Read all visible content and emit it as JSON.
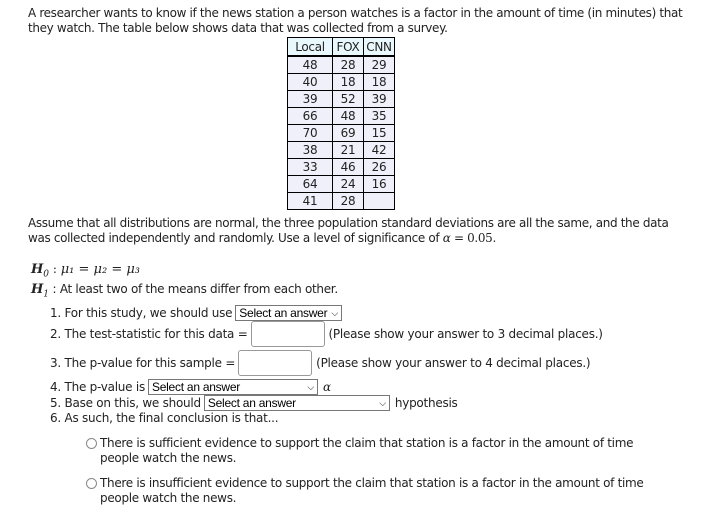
{
  "intro": "A researcher wants to know if the news station a person watches is a factor in the amount of time (in minutes) that they watch. The table below shows data that was collected from a survey.",
  "table": {
    "headers": [
      "Local",
      "FOX",
      "CNN"
    ],
    "rows": [
      [
        "48",
        "28",
        "29"
      ],
      [
        "40",
        "18",
        "18"
      ],
      [
        "39",
        "52",
        "39"
      ],
      [
        "66",
        "48",
        "35"
      ],
      [
        "70",
        "69",
        "15"
      ],
      [
        "38",
        "21",
        "42"
      ],
      [
        "33",
        "46",
        "26"
      ],
      [
        "64",
        "24",
        "16"
      ],
      [
        "41",
        "28",
        ""
      ]
    ]
  },
  "assumptions": {
    "text": "Assume that all distributions are normal, the three population standard deviations are all the same, and the data was collected independently and randomly. Use a level of significance of ",
    "alpha_symbol": "α",
    "alpha_eq": " = 0.05",
    "end": "."
  },
  "hypotheses": {
    "h0_label": "H",
    "h0_sub": "0",
    "h0_expr": "μ₁ = μ₂ = μ₃",
    "h1_label": "H",
    "h1_sub": "1",
    "h1_text": "At least two of the means differ from each other."
  },
  "questions": {
    "q1_label": "1. For this study, we should use",
    "q1_select": "Select an answer",
    "q2_label": "2. The test-statistic for this data =",
    "q2_value": "",
    "q2_note": "(Please show your answer to 3 decimal places.)",
    "q3_label": "3. The p-value for this sample =",
    "q3_value": "",
    "q3_note": "(Please show your answer to 4 decimal places.)",
    "q4_label": "4. The p-value is",
    "q4_select": "Select an answer",
    "q4_suffix": "α",
    "q5_label": "5. Base on this, we should",
    "q5_select": "Select an answer",
    "q5_suffix": "hypothesis",
    "q6_label": "6. As such, the final conclusion is that..."
  },
  "conclusions": [
    "There is sufficient evidence to support the claim that station is a factor in the amount of time people watch the news.",
    "There is insufficient evidence to support the claim that station is a factor in the amount of time people watch the news."
  ]
}
